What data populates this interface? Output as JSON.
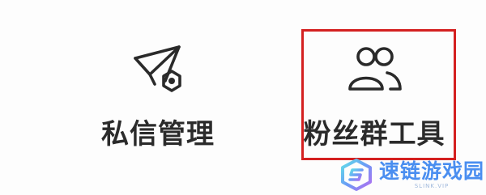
{
  "menu": {
    "items": [
      {
        "label": "私信管理",
        "icon": "paper-plane-gear-icon"
      },
      {
        "label": "粉丝群工具",
        "icon": "users-icon"
      }
    ]
  },
  "highlight": {
    "color": "#d42020"
  },
  "watermark": {
    "name": "速链游戏园",
    "subtext": "SLINK.VIP"
  }
}
